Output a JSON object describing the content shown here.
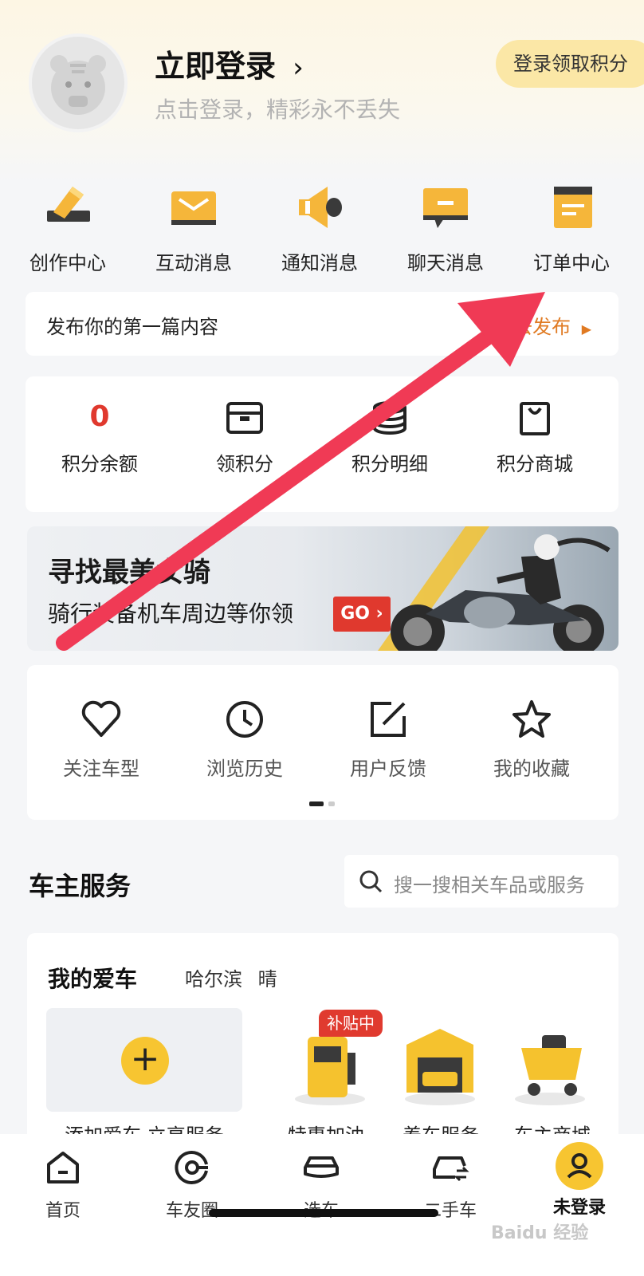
{
  "header": {
    "login_title": "立即登录",
    "login_subtitle": "点击登录，精彩永不丢失",
    "points_pill": "登录领取积分"
  },
  "top_menu": [
    {
      "label": "创作中心",
      "icon": "pen-icon"
    },
    {
      "label": "互动消息",
      "icon": "envelope-icon"
    },
    {
      "label": "通知消息",
      "icon": "megaphone-icon"
    },
    {
      "label": "聊天消息",
      "icon": "chat-bubble-icon"
    },
    {
      "label": "订单中心",
      "icon": "order-list-icon"
    }
  ],
  "publish": {
    "text": "发布你的第一篇内容",
    "link": "去发布"
  },
  "points": {
    "balance_value": "0",
    "items": [
      {
        "label": "积分余额"
      },
      {
        "label": "领积分",
        "icon": "gift-box-icon"
      },
      {
        "label": "积分明细",
        "icon": "coin-stack-icon"
      },
      {
        "label": "积分商城",
        "icon": "shopping-bag-icon"
      }
    ]
  },
  "banner": {
    "title": "寻找最美女骑",
    "subtitle": "骑行装备机车周边等你领",
    "cta": "GO"
  },
  "shortcuts": [
    {
      "label": "关注车型",
      "icon": "heart-icon"
    },
    {
      "label": "浏览历史",
      "icon": "clock-icon"
    },
    {
      "label": "用户反馈",
      "icon": "edit-icon"
    },
    {
      "label": "我的收藏",
      "icon": "star-icon"
    }
  ],
  "service": {
    "title": "车主服务",
    "search_placeholder": "搜一搜相关车品或服务"
  },
  "my_car": {
    "title": "我的爱车",
    "city": "哈尔滨",
    "weather": "晴",
    "add_label": "添加爱车 立享服务",
    "badge": "补贴中",
    "items": [
      {
        "label": "特惠加油",
        "icon": "fuel-pump-icon"
      },
      {
        "label": "养车服务",
        "icon": "garage-icon"
      },
      {
        "label": "车主商城",
        "icon": "shopping-cart-icon"
      }
    ]
  },
  "bottom_nav": [
    {
      "label": "首页",
      "icon": "home-icon"
    },
    {
      "label": "车友圈",
      "icon": "circle-icon"
    },
    {
      "label": "选车",
      "icon": "car-icon"
    },
    {
      "label": "二手车",
      "icon": "used-car-icon"
    },
    {
      "label": "未登录",
      "icon": "user-icon",
      "active": true
    }
  ],
  "watermark": "Baidu 经验",
  "colors": {
    "accent_yellow": "#f7c531",
    "accent_red": "#e0392e",
    "link_orange": "#e07a22",
    "arrow_red": "#f03a55"
  }
}
